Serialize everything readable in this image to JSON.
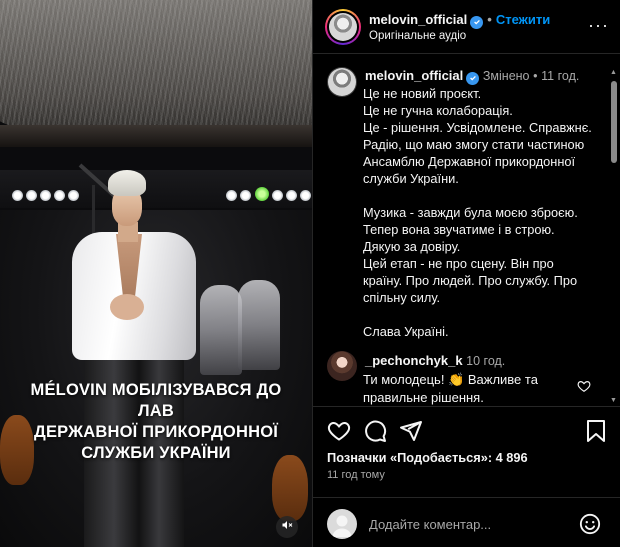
{
  "media": {
    "caption_lines": [
      "MÉLOVIN МОБІЛІЗУВАВСЯ ДО ЛАВ",
      "ДЕРЖАВНОЇ ПРИКОРДОННОЇ",
      "СЛУЖБИ УКРАЇНИ"
    ]
  },
  "header": {
    "username": "melovin_official",
    "separator": "•",
    "follow_label": "Стежити",
    "audio_label": "Оригінальне аудіо",
    "more_label": "···"
  },
  "caption": {
    "username": "melovin_official",
    "edited_label": "Змінено",
    "separator": "•",
    "time": "11 год.",
    "lines": [
      "Це не новий проєкт.",
      "Це не гучна колаборація.",
      "Це - рішення. Усвідомлене. Справжнє.",
      "Радію, що маю змогу стати частиною",
      "Ансамблю Державної прикордонної",
      "служби України.",
      "",
      "Музика - завжди була моєю зброєю.",
      "Тепер вона звучатиме і в строю.",
      "Дякую за довіру.",
      "Цей етап - не про сцену. Він про",
      "країну. Про людей. Про службу. Про",
      "спільну силу.",
      "",
      "Слава Україні."
    ]
  },
  "comment": {
    "username": "_pechonchyk_k",
    "time": "10 год.",
    "line1": "Ти молодець! 👏 Важливе та",
    "line2": "правильне рішення."
  },
  "likes": {
    "label": "Позначки «Подобається»: 4 896"
  },
  "timestamp": "11 год тому",
  "add_comment": {
    "placeholder": "Додайте коментар..."
  },
  "icons": [
    "heart-icon",
    "comment-icon",
    "share-icon",
    "bookmark-icon",
    "emoji-icon",
    "mute-icon",
    "verified-icon",
    "more-icon"
  ],
  "colors": {
    "link_blue": "#0095f6",
    "verified_blue": "#3897f0",
    "muted_text": "#a8a8a8",
    "background": "#000000"
  }
}
